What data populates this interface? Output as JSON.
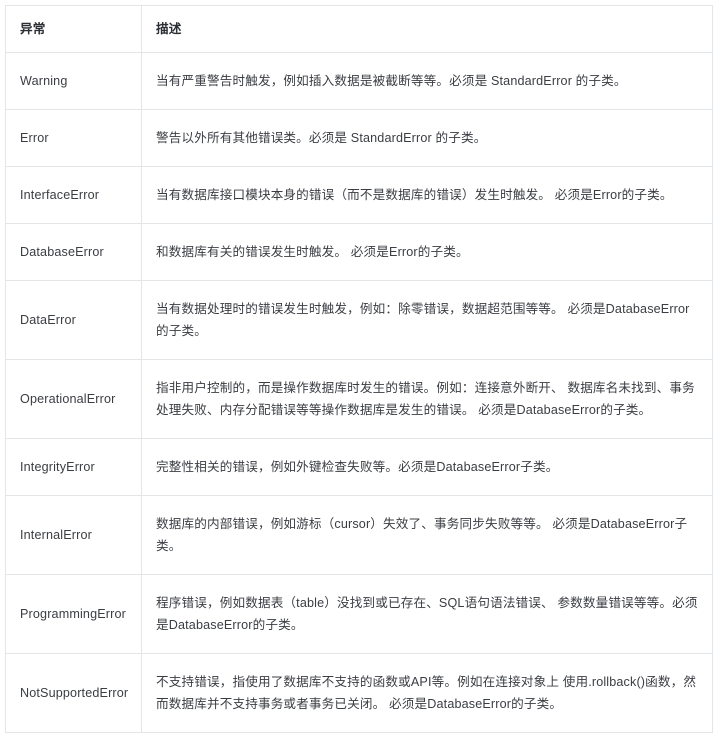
{
  "table": {
    "headers": [
      "异常",
      "描述"
    ],
    "rows": [
      {
        "name": "Warning",
        "desc": "当有严重警告时触发，例如插入数据是被截断等等。必须是 StandardError 的子类。",
        "lines": 1
      },
      {
        "name": "Error",
        "desc": "警告以外所有其他错误类。必须是 StandardError 的子类。",
        "lines": 1
      },
      {
        "name": "InterfaceError",
        "desc": "当有数据库接口模块本身的错误（而不是数据库的错误）发生时触发。 必须是Error的子类。",
        "lines": 1
      },
      {
        "name": "DatabaseError",
        "desc": "和数据库有关的错误发生时触发。 必须是Error的子类。",
        "lines": 1
      },
      {
        "name": "DataError",
        "desc": "当有数据处理时的错误发生时触发，例如：除零错误，数据超范围等等。 必须是DatabaseError的子类。",
        "lines": 2
      },
      {
        "name": "OperationalError",
        "desc": "指非用户控制的，而是操作数据库时发生的错误。例如：连接意外断开、 数据库名未找到、事务处理失败、内存分配错误等等操作数据库是发生的错误。 必须是DatabaseError的子类。",
        "lines": 2
      },
      {
        "name": "IntegrityError",
        "desc": "完整性相关的错误，例如外键检查失败等。必须是DatabaseError子类。",
        "lines": 1
      },
      {
        "name": "InternalError",
        "desc": "数据库的内部错误，例如游标（cursor）失效了、事务同步失败等等。 必须是DatabaseError子类。",
        "lines": 2
      },
      {
        "name": "ProgrammingError",
        "desc": "程序错误，例如数据表（table）没找到或已存在、SQL语句语法错误、 参数数量错误等等。必须是DatabaseError的子类。",
        "lines": 2
      },
      {
        "name": "NotSupportedError",
        "desc": "不支持错误，指使用了数据库不支持的函数或API等。例如在连接对象上 使用.rollback()函数，然而数据库并不支持事务或者事务已关闭。 必须是DatabaseError的子类。",
        "lines": 2
      }
    ]
  },
  "colors": {
    "border": "#e3e6e8",
    "text": "#3a3d42",
    "header_text": "#2b2e33",
    "background": "#ffffff"
  }
}
